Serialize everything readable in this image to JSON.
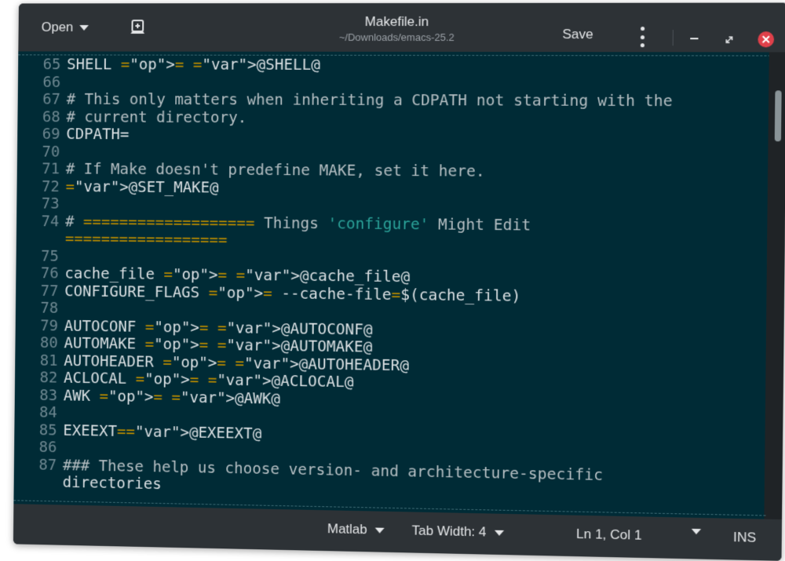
{
  "header": {
    "open_label": "Open",
    "title": "Makefile.in",
    "subtitle": "~/Downloads/emacs-25.2",
    "save_label": "Save"
  },
  "editor": {
    "lines": [
      {
        "n": "65",
        "t": "SHELL = @SHELL@"
      },
      {
        "n": "66",
        "t": ""
      },
      {
        "n": "67",
        "t": "# This only matters when inheriting a CDPATH not starting with the"
      },
      {
        "n": "68",
        "t": "# current directory."
      },
      {
        "n": "69",
        "t": "CDPATH="
      },
      {
        "n": "70",
        "t": ""
      },
      {
        "n": "71",
        "t": "# If Make doesn't predefine MAKE, set it here."
      },
      {
        "n": "72",
        "t": "@SET_MAKE@"
      },
      {
        "n": "73",
        "t": ""
      },
      {
        "n": "74",
        "t": "# =================== Things 'configure' Might Edit"
      },
      {
        "n": "",
        "t": "=================="
      },
      {
        "n": "75",
        "t": ""
      },
      {
        "n": "76",
        "t": "cache_file = @cache_file@"
      },
      {
        "n": "77",
        "t": "CONFIGURE_FLAGS = --cache-file=$(cache_file)"
      },
      {
        "n": "78",
        "t": ""
      },
      {
        "n": "79",
        "t": "AUTOCONF = @AUTOCONF@"
      },
      {
        "n": "80",
        "t": "AUTOMAKE = @AUTOMAKE@"
      },
      {
        "n": "81",
        "t": "AUTOHEADER = @AUTOHEADER@"
      },
      {
        "n": "82",
        "t": "ACLOCAL = @ACLOCAL@"
      },
      {
        "n": "83",
        "t": "AWK = @AWK@"
      },
      {
        "n": "84",
        "t": ""
      },
      {
        "n": "85",
        "t": "EXEEXT=@EXEEXT@"
      },
      {
        "n": "86",
        "t": ""
      },
      {
        "n": "87",
        "t": "### These help us choose version- and architecture-specific"
      },
      {
        "n": "",
        "t": "directories"
      }
    ]
  },
  "status": {
    "language": "Matlab",
    "tab_width": "Tab Width: 4",
    "position": "Ln 1, Col 1",
    "mode": "INS"
  },
  "icons": {
    "open": "chevron-down-icon",
    "new_document": "new-document-icon",
    "menu": "kebab-menu-icon",
    "minimize": "minimize-icon",
    "maximize": "maximize-icon",
    "close": "close-icon"
  },
  "colors": {
    "editor_bg": "#002b36",
    "variable": "#d4a516",
    "string": "#2aa198",
    "close_button": "#e0404a"
  }
}
